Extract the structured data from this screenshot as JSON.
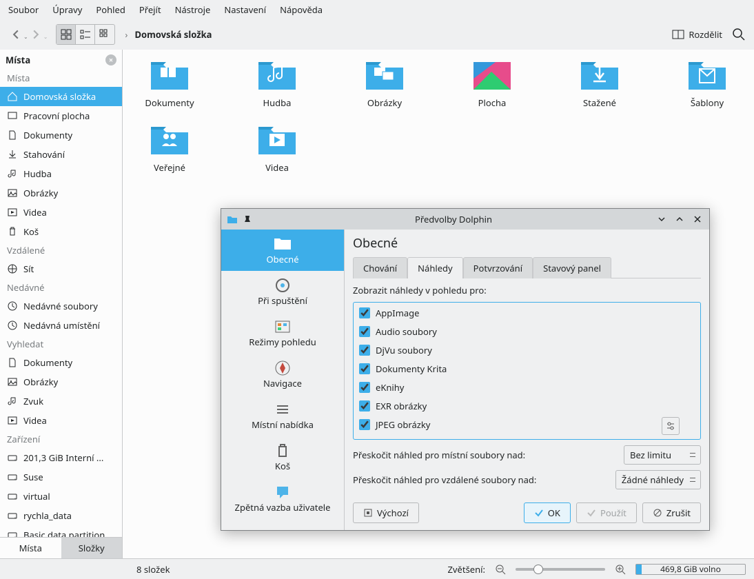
{
  "menu": {
    "file": "Soubor",
    "edit": "Úpravy",
    "view": "Pohled",
    "go": "Přejít",
    "tools": "Nástroje",
    "settings": "Nastavení",
    "help": "Nápověda"
  },
  "toolbar": {
    "breadcrumb": "Domovská složka",
    "split": "Rozdělit"
  },
  "sidebar": {
    "title": "Místa",
    "sections": {
      "places": "Místa",
      "remote": "Vzdálené",
      "recent": "Nedávné",
      "search": "Vyhledat",
      "devices": "Zařízení"
    },
    "places": [
      {
        "label": "Domovská složka"
      },
      {
        "label": "Pracovní plocha"
      },
      {
        "label": "Dokumenty"
      },
      {
        "label": "Stahování"
      },
      {
        "label": "Hudba"
      },
      {
        "label": "Obrázky"
      },
      {
        "label": "Videa"
      },
      {
        "label": "Koš"
      }
    ],
    "remote": [
      {
        "label": "Síť"
      }
    ],
    "recent": [
      {
        "label": "Nedávné soubory"
      },
      {
        "label": "Nedávná umístění"
      }
    ],
    "search": [
      {
        "label": "Dokumenty"
      },
      {
        "label": "Obrázky"
      },
      {
        "label": "Zvuk"
      },
      {
        "label": "Videa"
      }
    ],
    "devices": [
      {
        "label": "201,3 GiB Interní ..."
      },
      {
        "label": "Suse"
      },
      {
        "label": "virtual"
      },
      {
        "label": "rychla_data"
      },
      {
        "label": "Basic data partition"
      }
    ],
    "tab_places": "Místa",
    "tab_folders": "Složky"
  },
  "folders": [
    {
      "label": "Dokumenty"
    },
    {
      "label": "Hudba"
    },
    {
      "label": "Obrázky"
    },
    {
      "label": "Plocha"
    },
    {
      "label": "Stažené"
    },
    {
      "label": "Šablony"
    },
    {
      "label": "Veřejné"
    },
    {
      "label": "Videa"
    }
  ],
  "statusbar": {
    "count": "8 složek",
    "zoom_label": "Zvětšení:",
    "free_space": "469,8 GiB volno"
  },
  "dialog": {
    "title": "Předvolby Dolphin",
    "categories": [
      {
        "label": "Obecné"
      },
      {
        "label": "Při spuštění"
      },
      {
        "label": "Režimy pohledu"
      },
      {
        "label": "Navigace"
      },
      {
        "label": "Místní nabídka"
      },
      {
        "label": "Koš"
      },
      {
        "label": "Zpětná vazba uživatele"
      }
    ],
    "heading": "Obecné",
    "tabs": {
      "behavior": "Chování",
      "previews": "Náhledy",
      "confirm": "Potvrzování",
      "status": "Stavový panel"
    },
    "preview_prompt": "Zobrazit náhledy v pohledu pro:",
    "checks": [
      "AppImage",
      "Audio soubory",
      "DjVu soubory",
      "Dokumenty Krita",
      "eKnihy",
      "EXR obrázky",
      "JPEG obrázky"
    ],
    "skip_local": "Přeskočit náhled pro místní soubory nad:",
    "skip_remote": "Přeskočit náhled pro vzdálené soubory nad:",
    "combo_local": "Bez limitu",
    "combo_remote": "Žádné náhledy",
    "btn_defaults": "Výchozí",
    "btn_ok": "OK",
    "btn_apply": "Použít",
    "btn_cancel": "Zrušit"
  }
}
